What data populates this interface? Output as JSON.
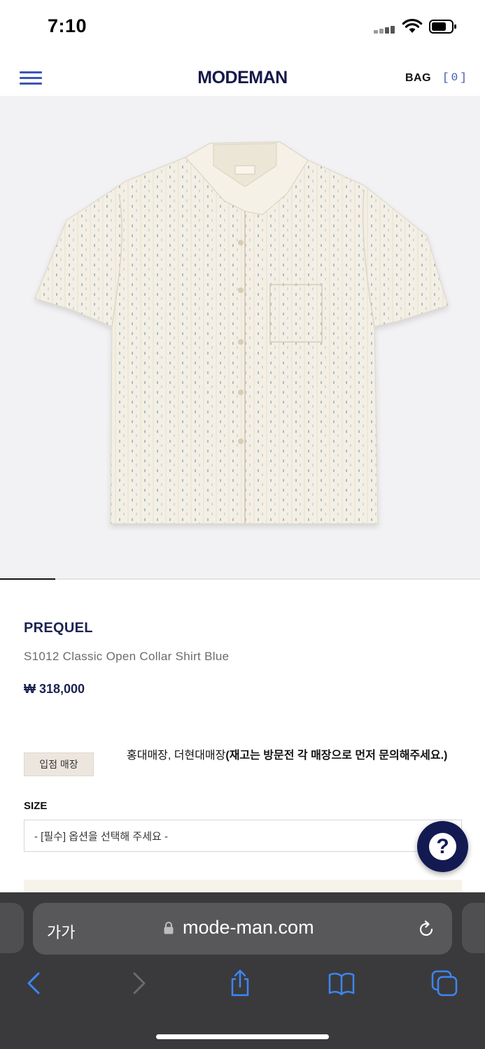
{
  "status_bar": {
    "time": "7:10"
  },
  "header": {
    "logo": "MODEMAN",
    "bag_label": "BAG",
    "bag_count": "[0]"
  },
  "gallery": {
    "progress": 0.115
  },
  "product": {
    "brand": "PREQUEL",
    "name": "S1012 Classic Open Collar Shirt Blue",
    "price": "₩ 318,000"
  },
  "store": {
    "badge": "입점 매장",
    "stores": "홍대매장, 더현대매장",
    "note": "(재고는 방문전 각 매장으로 먼저 문의해주세요.)"
  },
  "size": {
    "label": "SIZE",
    "placeholder": "- [필수] 옵션을 선택해 주세요 -"
  },
  "browser": {
    "text_size": "가가",
    "url": "mode-man.com"
  },
  "colors": {
    "accent": "#3a57b5",
    "brand_navy": "#1b2350",
    "help_button": "#131a52"
  }
}
